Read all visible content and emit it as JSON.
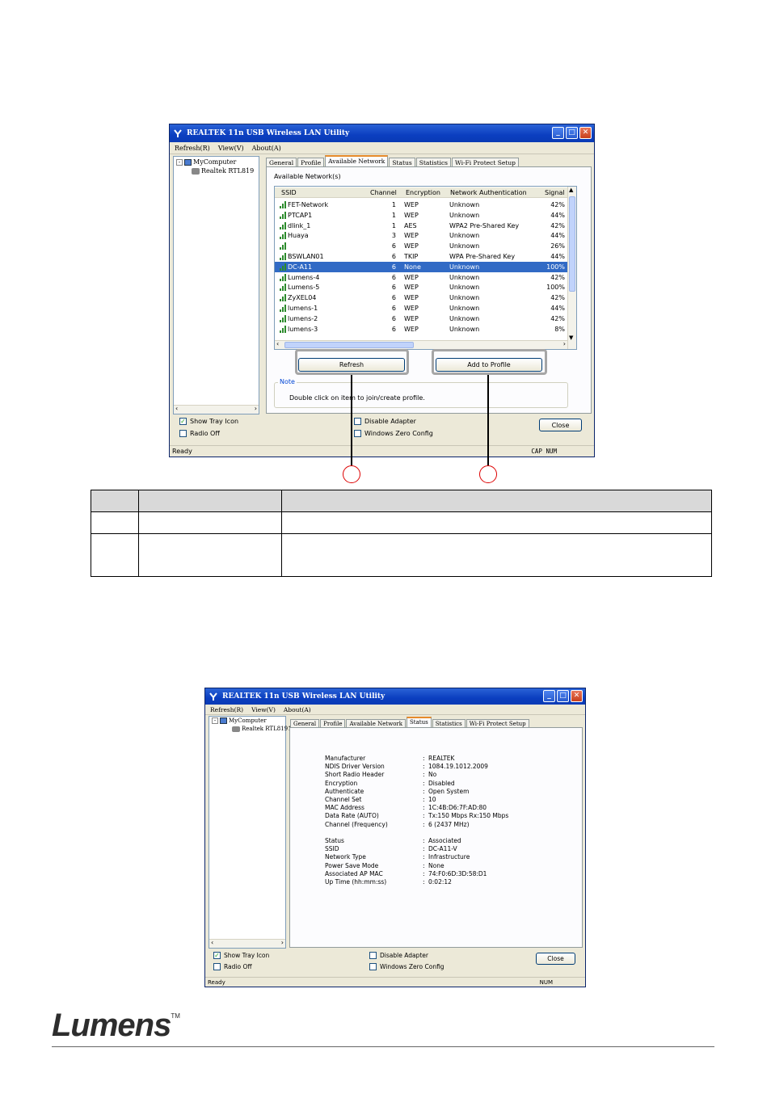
{
  "window1": {
    "title": "REALTEK 11n USB Wireless LAN Utility",
    "menu": [
      "Refresh(R)",
      "View(V)",
      "About(A)"
    ],
    "tree": {
      "root": "MyComputer",
      "child": "Realtek RTL819"
    },
    "tabs": [
      "General",
      "Profile",
      "Available Network",
      "Status",
      "Statistics",
      "Wi-Fi Protect Setup"
    ],
    "active_tab": "Available Network",
    "group_label": "Available Network(s)",
    "columns": [
      "SSID",
      "Channel",
      "Encryption",
      "Network Authentication",
      "Signal"
    ],
    "networks": [
      {
        "ssid": "FET-Network",
        "channel": "1",
        "encryption": "WEP",
        "auth": "Unknown",
        "signal": "42%"
      },
      {
        "ssid": "PTCAP1",
        "channel": "1",
        "encryption": "WEP",
        "auth": "Unknown",
        "signal": "44%"
      },
      {
        "ssid": "dlink_1",
        "channel": "1",
        "encryption": "AES",
        "auth": "WPA2 Pre-Shared Key",
        "signal": "42%"
      },
      {
        "ssid": "Huaya",
        "channel": "3",
        "encryption": "WEP",
        "auth": "Unknown",
        "signal": "44%"
      },
      {
        "ssid": "",
        "channel": "6",
        "encryption": "WEP",
        "auth": "Unknown",
        "signal": "26%"
      },
      {
        "ssid": "BSWLAN01",
        "channel": "6",
        "encryption": "TKIP",
        "auth": "WPA Pre-Shared Key",
        "signal": "44%"
      },
      {
        "ssid": "DC-A11",
        "channel": "6",
        "encryption": "None",
        "auth": "Unknown",
        "signal": "100%",
        "selected": true
      },
      {
        "ssid": "Lumens-4",
        "channel": "6",
        "encryption": "WEP",
        "auth": "Unknown",
        "signal": "42%"
      },
      {
        "ssid": "Lumens-5",
        "channel": "6",
        "encryption": "WEP",
        "auth": "Unknown",
        "signal": "100%"
      },
      {
        "ssid": "ZyXEL04",
        "channel": "6",
        "encryption": "WEP",
        "auth": "Unknown",
        "signal": "42%"
      },
      {
        "ssid": "lumens-1",
        "channel": "6",
        "encryption": "WEP",
        "auth": "Unknown",
        "signal": "44%"
      },
      {
        "ssid": "lumens-2",
        "channel": "6",
        "encryption": "WEP",
        "auth": "Unknown",
        "signal": "42%"
      },
      {
        "ssid": "lumens-3",
        "channel": "6",
        "encryption": "WEP",
        "auth": "Unknown",
        "signal": "8%"
      }
    ],
    "refresh_label": "Refresh",
    "add_profile_label": "Add to Profile",
    "note_label": "Note",
    "note_text": "Double click on item to join/create profile.",
    "show_tray_icon": "Show Tray Icon",
    "radio_off": "Radio Off",
    "disable_adapter": "Disable Adapter",
    "windows_zero_config": "Windows Zero Config",
    "close_label": "Close",
    "status_left": "Ready",
    "status_right": "CAP  NUM"
  },
  "window2": {
    "title": "REALTEK 11n USB Wireless LAN Utility",
    "menu": [
      "Refresh(R)",
      "View(V)",
      "About(A)"
    ],
    "tree": {
      "root": "MyComputer",
      "child": "Realtek RTL8191"
    },
    "tabs": [
      "General",
      "Profile",
      "Available Network",
      "Status",
      "Statistics",
      "Wi-Fi Protect Setup"
    ],
    "active_tab": "Status",
    "info_group1": [
      {
        "label": "Manufacturer",
        "value": "REALTEK"
      },
      {
        "label": "NDIS Driver Version",
        "value": "1084.19.1012.2009"
      },
      {
        "label": "Short Radio Header",
        "value": "No"
      },
      {
        "label": "Encryption",
        "value": "Disabled"
      },
      {
        "label": "Authenticate",
        "value": "Open System"
      },
      {
        "label": "Channel Set",
        "value": "10"
      },
      {
        "label": "MAC Address",
        "value": "1C:4B:D6:7F:AD:80"
      },
      {
        "label": "Data Rate (AUTO)",
        "value": "Tx:150 Mbps Rx:150 Mbps"
      },
      {
        "label": "Channel (Frequency)",
        "value": "6 (2437 MHz)"
      }
    ],
    "info_group2": [
      {
        "label": "Status",
        "value": "Associated"
      },
      {
        "label": "SSID",
        "value": "DC-A11-V"
      },
      {
        "label": "Network Type",
        "value": "Infrastructure"
      },
      {
        "label": "Power Save Mode",
        "value": "None"
      },
      {
        "label": "Associated AP MAC",
        "value": "74:F0:6D:3D:58:D1"
      },
      {
        "label": "Up Time (hh:mm:ss)",
        "value": "0:02:12"
      }
    ],
    "separator": ":",
    "show_tray_icon": "Show Tray Icon",
    "radio_off": "Radio Off",
    "disable_adapter": "Disable Adapter",
    "windows_zero_config": "Windows Zero Config",
    "close_label": "Close",
    "status_left": "Ready",
    "status_right": "NUM"
  },
  "logo": {
    "name": "Lumens",
    "tm": "TM"
  },
  "colors": {
    "callout": "#a6a6a6",
    "marker": "#dd0000",
    "selection": "#316ac5",
    "titlebar": "#0b3ec0"
  }
}
